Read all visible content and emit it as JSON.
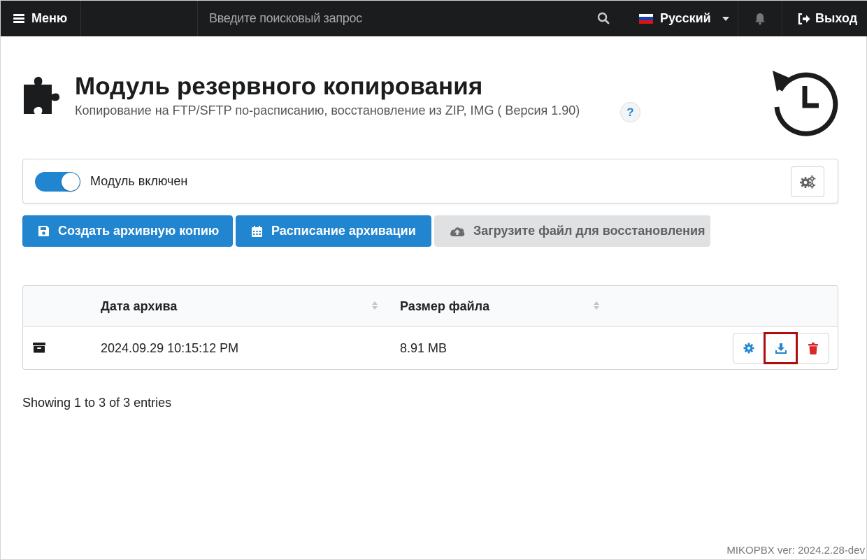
{
  "topbar": {
    "menu_label": "Меню",
    "search_placeholder": "Введите поисковый запрос",
    "language": "Русский",
    "exit_label": "Выход"
  },
  "header": {
    "title": "Модуль резервного копирования",
    "subtitle": "Копирование на FTP/SFTP по-расписанию, восстановление из ZIP, IMG ( Версия 1.90)",
    "help": "?"
  },
  "module_panel": {
    "toggle_label": "Модуль включен",
    "enabled": true
  },
  "actions": {
    "create_backup": "Создать архивную копию",
    "schedule": "Расписание архивации",
    "upload_restore": "Загрузите файл для восстановления"
  },
  "table": {
    "columns": [
      "Дата архива",
      "Размер файла"
    ],
    "rows": [
      {
        "date": "2024.09.29 10:15:12 PM",
        "size": "8.91 MB"
      }
    ]
  },
  "footer": {
    "entries_info": "Showing 1 to 3 of 3 entries",
    "version": "MIKOPBX ver: 2024.2.28-dev"
  },
  "colors": {
    "primary": "#2185d0",
    "danger": "#db2828",
    "topbar": "#1b1c1d",
    "highlight": "#b00d0d"
  },
  "icons": [
    "bars-icon",
    "search-icon",
    "russia-flag-icon",
    "bell-icon",
    "sign-out-icon",
    "puzzle-icon",
    "history-icon",
    "cogs-icon",
    "save-icon",
    "calendar-icon",
    "cloud-upload-icon",
    "sort-icon",
    "archive-icon",
    "cog-icon",
    "download-icon",
    "trash-icon"
  ]
}
